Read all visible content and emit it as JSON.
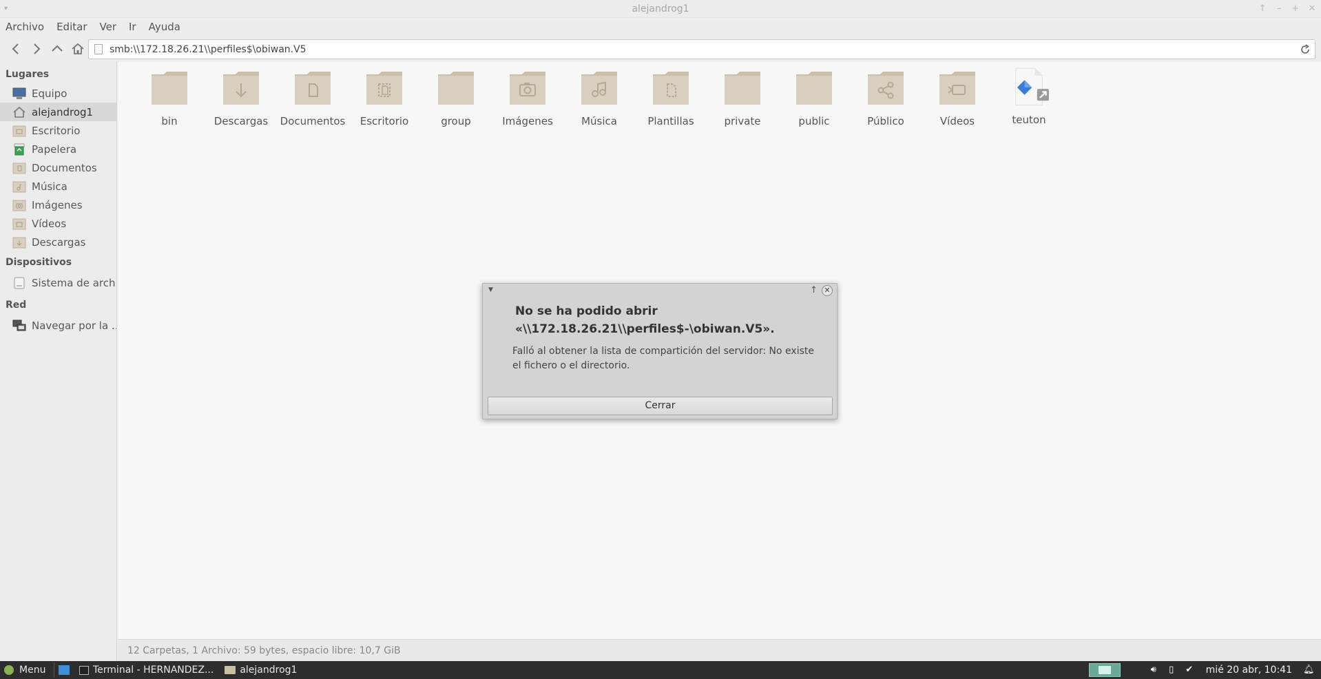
{
  "window": {
    "title": "alejandrog1"
  },
  "menubar": {
    "items": [
      "Archivo",
      "Editar",
      "Ver",
      "Ir",
      "Ayuda"
    ]
  },
  "location": {
    "path": "smb:\\\\172.18.26.21\\\\perfiles$\\obiwan.V5"
  },
  "sidebar": {
    "sections": {
      "places": "Lugares",
      "devices": "Dispositivos",
      "network": "Red"
    },
    "places": [
      {
        "label": "Equipo",
        "icon": "computer-icon"
      },
      {
        "label": "alejandrog1",
        "icon": "home-icon"
      },
      {
        "label": "Escritorio",
        "icon": "desktop-folder-icon"
      },
      {
        "label": "Papelera",
        "icon": "trash-icon"
      },
      {
        "label": "Documentos",
        "icon": "documents-folder-icon"
      },
      {
        "label": "Música",
        "icon": "music-folder-icon"
      },
      {
        "label": "Imágenes",
        "icon": "pictures-folder-icon"
      },
      {
        "label": "Vídeos",
        "icon": "videos-folder-icon"
      },
      {
        "label": "Descargas",
        "icon": "downloads-folder-icon"
      }
    ],
    "devices": [
      {
        "label": "Sistema de arch...",
        "icon": "drive-icon"
      }
    ],
    "network": [
      {
        "label": "Navegar por la ...",
        "icon": "network-icon"
      }
    ]
  },
  "files": [
    {
      "name": "bin",
      "icon": "folder-icon"
    },
    {
      "name": "Descargas",
      "icon": "downloads-folder-icon"
    },
    {
      "name": "Documentos",
      "icon": "documents-folder-icon"
    },
    {
      "name": "Escritorio",
      "icon": "desktop-folder-icon"
    },
    {
      "name": "group",
      "icon": "folder-icon"
    },
    {
      "name": "Imágenes",
      "icon": "pictures-folder-icon"
    },
    {
      "name": "Música",
      "icon": "music-folder-icon"
    },
    {
      "name": "Plantillas",
      "icon": "templates-folder-icon"
    },
    {
      "name": "private",
      "icon": "folder-icon"
    },
    {
      "name": "public",
      "icon": "folder-icon"
    },
    {
      "name": "Público",
      "icon": "public-share-folder-icon"
    },
    {
      "name": "Vídeos",
      "icon": "videos-folder-icon"
    },
    {
      "name": "teuton",
      "icon": "symlink-file-icon"
    }
  ],
  "status": {
    "text": "12 Carpetas, 1 Archivo: 59 bytes, espacio libre: 10,7 GiB"
  },
  "dialog": {
    "heading": "No se ha podido abrir «\\\\172.18.26.21\\\\perfiles$-\\obiwan.V5».",
    "message": "Falló al obtener la lista de compartición del servidor: No existe el fichero o el directorio.",
    "close_button": "Cerrar"
  },
  "taskbar": {
    "menu_label": "Menu",
    "tasks": [
      "Terminal - HERNANDEZ...",
      "alejandrog1"
    ],
    "clock": "mié 20 abr, 10:41"
  },
  "colors": {
    "folder": "#d9cfbf",
    "folder_dark": "#cbbfab",
    "folder_emblem": "#b3a893",
    "taskbar": "#2d2d2d",
    "accent_link": "#3a7bd5"
  }
}
